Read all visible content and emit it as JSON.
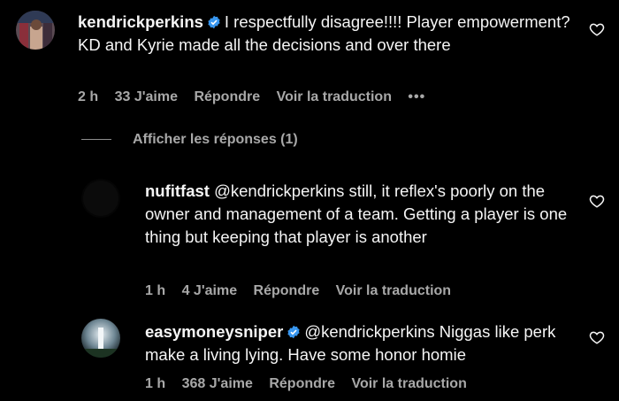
{
  "comments": [
    {
      "username": "kendrickperkins",
      "verified": true,
      "text": "I respectfully disagree!!!! Player empowerment? KD and Kyrie made all the decisions and over there",
      "time": "2 h",
      "likes": "33 J'aime",
      "reply": "Répondre",
      "translate": "Voir la traduction",
      "more": "•••"
    },
    {
      "username": "nufitfast",
      "verified": false,
      "text": "@kendrickperkins still, it reflex's poorly on the owner and management of a team. Getting a player is one thing but keeping that player is another",
      "time": "1 h",
      "likes": "4 J'aime",
      "reply": "Répondre",
      "translate": "Voir la traduction"
    },
    {
      "username": "easymoneysniper",
      "verified": true,
      "text": "@kendrickperkins Niggas like perk make a living lying. Have some honor homie",
      "time": "1 h",
      "likes": "368 J'aime",
      "reply": "Répondre",
      "translate": "Voir la traduction"
    }
  ],
  "replies_toggle": "Afficher les réponses (1)",
  "colors": {
    "background": "#000000",
    "text": "#f5f5f5",
    "meta": "#a8a8a8",
    "verified": "#3897f0"
  }
}
